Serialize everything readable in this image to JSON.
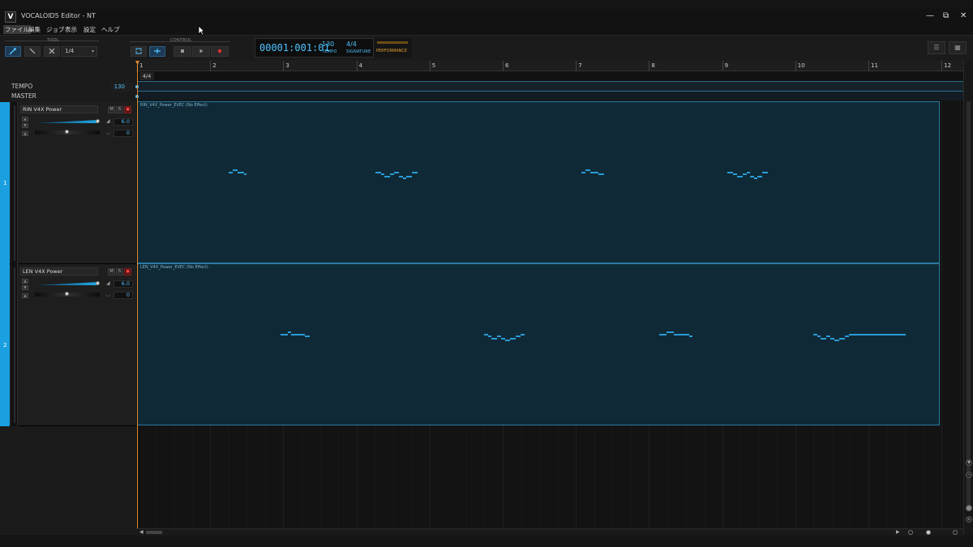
{
  "window": {
    "logo": "V",
    "title": "VOCALOID5 Editor - NT",
    "minimize": "—",
    "restore": "⧉",
    "close": "✕"
  },
  "menu": [
    "ファイル",
    "編集",
    "ジョブ",
    "表示",
    "設定",
    "ヘルプ"
  ],
  "toolbar": {
    "tool_label": "TOOL",
    "control_label": "CONTROL",
    "quantize": "1/4",
    "tool_icons": [
      "pointer-icon",
      "pencil-icon",
      "eraser-icon"
    ],
    "control_icons": [
      "loop-icon",
      "auto-scroll-icon",
      "stop-icon",
      "play-icon",
      "record-icon"
    ]
  },
  "transport": {
    "position": "00001:001:01",
    "tempo_value": "130",
    "tempo_label": "TEMPO",
    "signature_value": "4/4",
    "signature_label": "SIGNATURE",
    "performance_label": "PERFORMANCE"
  },
  "ruler": {
    "bars": [
      "1",
      "2",
      "3",
      "4",
      "5",
      "6",
      "7",
      "8",
      "9",
      "10",
      "11",
      "12"
    ]
  },
  "global_tracks": {
    "tempo_label": "TEMPO",
    "tempo_value": "130",
    "master_label": "MASTER",
    "signature_chip": "4/4"
  },
  "tracks": [
    {
      "number": "1",
      "singer": "RIN V4X Power",
      "mute": "M",
      "solo": "S",
      "volume": "6.0",
      "pan": "0",
      "part_label": "RIN_V4X_Power_EVEC (No Effect)",
      "notes": [
        [
          9.9,
          10.4,
          4
        ],
        [
          10.4,
          10.9,
          5
        ],
        [
          10.9,
          11.6,
          4
        ],
        [
          11.6,
          11.9,
          3
        ],
        [
          26.0,
          26.6,
          4
        ],
        [
          26.6,
          27.0,
          3
        ],
        [
          27.0,
          27.6,
          2
        ],
        [
          27.6,
          28.0,
          3
        ],
        [
          28.0,
          28.6,
          4
        ],
        [
          28.6,
          29.0,
          2
        ],
        [
          29.0,
          29.4,
          1
        ],
        [
          29.4,
          30.0,
          2
        ],
        [
          30.0,
          30.6,
          4
        ],
        [
          48.5,
          49.0,
          4
        ],
        [
          49.0,
          49.5,
          5
        ],
        [
          49.5,
          50.4,
          4
        ],
        [
          50.4,
          51.0,
          3
        ],
        [
          64.5,
          65.1,
          4
        ],
        [
          65.1,
          65.5,
          3
        ],
        [
          65.5,
          66.2,
          2
        ],
        [
          66.2,
          66.6,
          3
        ],
        [
          66.6,
          67.0,
          4
        ],
        [
          67.0,
          67.4,
          2
        ],
        [
          67.4,
          67.8,
          1
        ],
        [
          67.8,
          68.3,
          2
        ],
        [
          68.3,
          68.9,
          4
        ]
      ]
    },
    {
      "number": "2",
      "singer": "LEN V4X Power",
      "mute": "M",
      "solo": "S",
      "volume": "6.0",
      "pan": "0",
      "part_label": "LEN_V4X_Power_EVEC (No Effect)",
      "notes": [
        [
          15.6,
          16.4,
          4
        ],
        [
          16.4,
          16.8,
          5
        ],
        [
          16.8,
          18.3,
          4
        ],
        [
          18.3,
          18.8,
          3
        ],
        [
          37.9,
          38.3,
          4
        ],
        [
          38.3,
          38.7,
          3
        ],
        [
          38.7,
          39.3,
          2
        ],
        [
          39.3,
          39.7,
          3
        ],
        [
          39.7,
          40.2,
          2
        ],
        [
          40.2,
          40.7,
          1
        ],
        [
          40.7,
          41.3,
          2
        ],
        [
          41.3,
          41.9,
          3
        ],
        [
          41.9,
          42.3,
          4
        ],
        [
          57.0,
          57.8,
          4
        ],
        [
          57.8,
          58.6,
          5
        ],
        [
          58.6,
          60.3,
          4
        ],
        [
          60.3,
          60.7,
          3
        ],
        [
          73.9,
          74.3,
          4
        ],
        [
          74.3,
          74.7,
          3
        ],
        [
          74.7,
          75.3,
          2
        ],
        [
          75.3,
          75.7,
          3
        ],
        [
          75.7,
          76.2,
          2
        ],
        [
          76.2,
          76.7,
          1
        ],
        [
          76.7,
          77.3,
          2
        ],
        [
          77.3,
          77.8,
          3
        ],
        [
          77.8,
          78.5,
          4
        ],
        [
          78.5,
          84.0,
          4
        ]
      ]
    }
  ],
  "accent_color": "#1a9fe0",
  "note_color": "#2b9ad6",
  "playhead_color": "#e28a2b"
}
